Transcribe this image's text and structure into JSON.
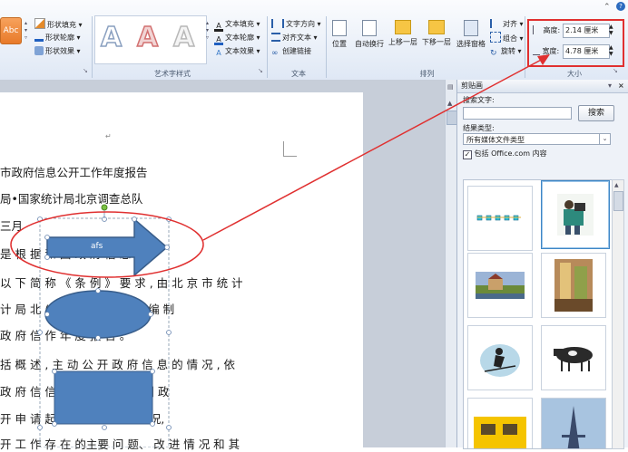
{
  "ribbon": {
    "shape_styles": {
      "style_sample": "Abc",
      "fill": "形状填充",
      "outline": "形状轮廓",
      "effects": "形状效果"
    },
    "wordart": {
      "group_label": "艺术字样式",
      "letters": [
        "A",
        "A",
        "A"
      ],
      "text_fill": "文本填充",
      "text_outline": "文本轮廓",
      "text_effects": "文本效果"
    },
    "text": {
      "group_label": "文本",
      "direction": "文字方向",
      "align": "对齐文本",
      "link": "创建链接"
    },
    "arrange": {
      "group_label": "排列",
      "position": "位置",
      "wrap": "自动换行",
      "bring_forward": "上移一层",
      "send_backward": "下移一层",
      "selection_pane": "选择窗格",
      "align": "对齐",
      "group": "组合",
      "rotate": "旋转"
    },
    "size": {
      "group_label": "大小",
      "height_label": "高度:",
      "height_value": "2.14 厘米",
      "width_label": "宽度:",
      "width_value": "4.78 厘米"
    }
  },
  "document": {
    "lines": [
      "市政府信息公开工作年度报告",
      "局•国家统计局北京调查总队",
      "三月",
      "是 根 据              和 国 政 府 信 息 公",
      "以 下 简 称 《 条 例 》 要 求 , 由 北 京 市 统 计",
      "计 局 北                 (以下简称统计局队) 编 制",
      "政 府 信                  作 年 度 报 告 。",
      "括 概 述 , 主 动 公 开 政 府 信 息 的 情 况 , 依",
      "政 府 信                  信息公开咨询情况, 因 政",
      "开 申 请                  起 行 政 诉 讼 的 情 况,",
      "开 工 作 存 在 的主要 问 题、 改 进 情 况 和 其"
    ],
    "arrow_text": "afs"
  },
  "clipart_pane": {
    "title": "剪贴画",
    "search_label": "搜索文字:",
    "search_value": "",
    "search_button": "搜索",
    "results_label": "结果类型:",
    "results_value": "所有媒体文件类型",
    "include_office": "包括 Office.com 内容",
    "include_checked": true,
    "thumbnails": [
      "bulbs-clipart",
      "photographer-clipart",
      "village-photo",
      "ruin-photo",
      "skier-clipart",
      "cow-clipart",
      "taxi-clipart",
      "eiffel-tower-photo"
    ]
  },
  "colors": {
    "shape_fill": "#4f81bd",
    "shape_stroke": "#385d8a",
    "annotation_red": "#e03030"
  }
}
